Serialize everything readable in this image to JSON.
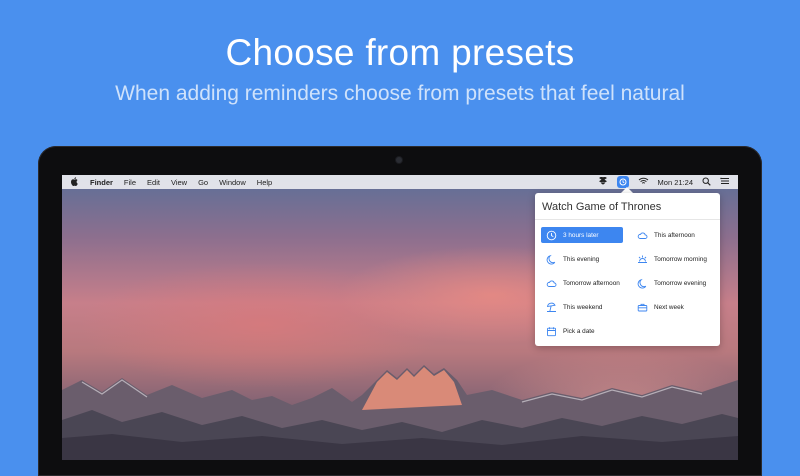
{
  "hero": {
    "title": "Choose from presets",
    "subtitle": "When adding reminders choose from presets that feel natural"
  },
  "menubar": {
    "apple_icon": "apple-icon",
    "app_name": "Finder",
    "menus": [
      "File",
      "Edit",
      "View",
      "Go",
      "Window",
      "Help"
    ],
    "clock": "Mon 21:24",
    "status_icons": [
      "dropbox-icon",
      "reminder-app-icon",
      "wifi-icon",
      "search-icon",
      "list-icon"
    ]
  },
  "popover": {
    "title": "Watch Game of Thrones",
    "presets": [
      {
        "label": "3 hours later",
        "icon": "clock-icon",
        "selected": true
      },
      {
        "label": "This afternoon",
        "icon": "cloud-icon"
      },
      {
        "label": "This evening",
        "icon": "moon-icon"
      },
      {
        "label": "Tomorrow morning",
        "icon": "sunrise-icon"
      },
      {
        "label": "Tomorrow afternoon",
        "icon": "cloud-icon"
      },
      {
        "label": "Tomorrow evening",
        "icon": "moon-icon"
      },
      {
        "label": "This weekend",
        "icon": "beach-icon"
      },
      {
        "label": "Next week",
        "icon": "briefcase-icon"
      },
      {
        "label": "Pick a date",
        "icon": "calendar-icon"
      }
    ]
  },
  "colors": {
    "background": "#4a90ee",
    "accent": "#3d86f0"
  }
}
